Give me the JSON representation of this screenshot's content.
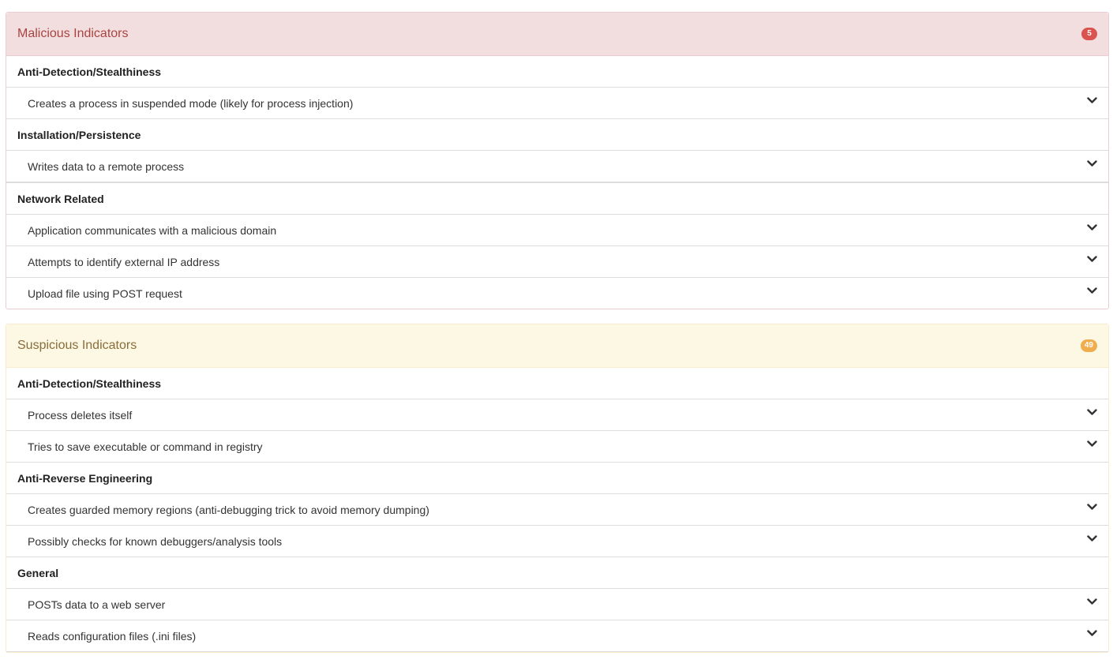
{
  "malicious": {
    "title": "Malicious Indicators",
    "count": "5",
    "categories": [
      {
        "name": "Anti-Detection/Stealthiness",
        "items": [
          "Creates a process in suspended mode (likely for process injection)"
        ]
      },
      {
        "name": "Installation/Persistence",
        "items": [
          "Writes data to a remote process"
        ]
      },
      {
        "name": "Network Related",
        "items": [
          "Application communicates with a malicious domain",
          "Attempts to identify external IP address",
          "Upload file using POST request"
        ]
      }
    ]
  },
  "suspicious": {
    "title": "Suspicious Indicators",
    "count": "49",
    "categories": [
      {
        "name": "Anti-Detection/Stealthiness",
        "items": [
          "Process deletes itself",
          "Tries to save executable or command in registry"
        ]
      },
      {
        "name": "Anti-Reverse Engineering",
        "items": [
          "Creates guarded memory regions (anti-debugging trick to avoid memory dumping)",
          "Possibly checks for known debuggers/analysis tools"
        ]
      },
      {
        "name": "General",
        "items": [
          "POSTs data to a web server",
          "Reads configuration files (.ini files)"
        ]
      }
    ]
  },
  "icons": {
    "expand": "chevron-down-icon"
  },
  "colors": {
    "malicious_bg": "#f2dede",
    "malicious_text": "#a94442",
    "malicious_badge": "#d9534f",
    "suspicious_bg": "#fcf8e3",
    "suspicious_text": "#8a6d3b",
    "suspicious_badge": "#f0ad4e"
  }
}
